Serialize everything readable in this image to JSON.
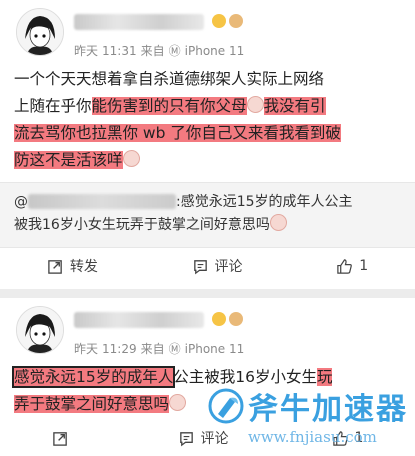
{
  "colors": {
    "highlight": "#f37a80",
    "watermark": "#3aa0e0"
  },
  "post1": {
    "meta": {
      "date": "昨天",
      "time": "11:31",
      "source_prefix": "来自",
      "device": "iPhone 11"
    },
    "text": {
      "line1": "一个个天天想着拿自杀道德绑架人实际上网络",
      "line2_plain": "上随在乎你",
      "line2_hl": "能伤害到的只有你父母",
      "line2_hl2": "我没有引",
      "line3_hl": "流去骂你也拉黑你 wb 了你自己又来看我看到破",
      "line4_hl": "防这不是活该咩"
    },
    "quote": {
      "prefix": "@",
      "line1": ":感觉永远15岁的成年人公主",
      "line2": "被我16岁小女生玩弄于鼓掌之间好意思吗"
    },
    "actions": {
      "repost": "转发",
      "comment": "评论",
      "like": "1"
    }
  },
  "post2": {
    "meta": {
      "date": "昨天",
      "time": "11:29",
      "source_prefix": "来自",
      "device": "iPhone 11"
    },
    "text": {
      "boxed_hl": "感觉永远15岁的成年人",
      "mid": "公主被我16岁小女生",
      "end_hl": "玩",
      "line2_hl": "弄于鼓掌之间好意思吗"
    },
    "actions": {
      "repost": "",
      "comment": "评论",
      "like": "1"
    }
  },
  "watermark": {
    "title": "斧牛加速器",
    "url": "www.fnjiasu.com",
    "logo": "axe-logo-icon"
  }
}
